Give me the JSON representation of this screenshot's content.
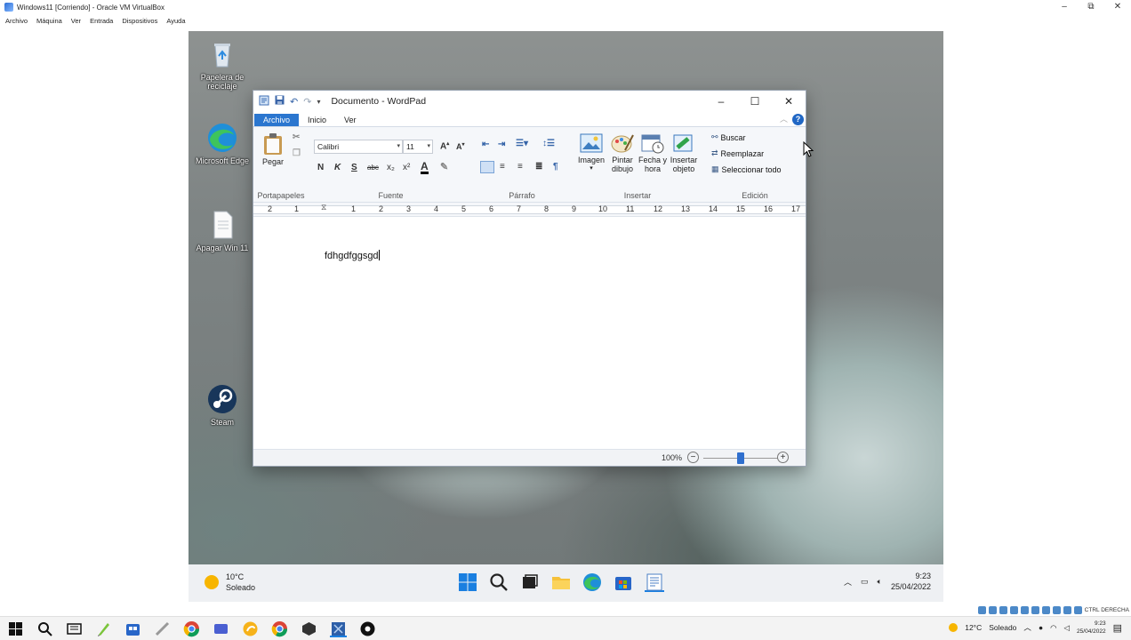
{
  "host": {
    "title": "Windows11 [Corriendo] - Oracle VM VirtualBox",
    "controls": [
      "–",
      "⧉",
      "✕"
    ],
    "menu": [
      "Archivo",
      "Máquina",
      "Ver",
      "Entrada",
      "Dispositivos",
      "Ayuda"
    ],
    "status_text": "CTRL DERECHA",
    "tray": {
      "temp": "12°C",
      "weather": "Soleado",
      "time": "9:23",
      "date": "25/04/2022"
    }
  },
  "desktop": {
    "icons": [
      {
        "label": "Papelera de reciclaje",
        "icon": "recycle-bin-icon"
      },
      {
        "label": "Microsoft Edge",
        "icon": "edge-icon"
      },
      {
        "label": "Apagar Win 11",
        "icon": "text-file-icon"
      },
      {
        "label": "Steam",
        "icon": "steam-icon"
      }
    ]
  },
  "wordpad": {
    "title": "Documento - WordPad",
    "tabs": {
      "file": "Archivo",
      "home": "Inicio",
      "view": "Ver"
    },
    "help": "?",
    "clipboard": {
      "paste": "Pegar",
      "label": "Portapapeles"
    },
    "font": {
      "family": "Calibri",
      "size": "11",
      "label": "Fuente",
      "bold": "N",
      "italic": "K",
      "underline": "S",
      "strike": "abc",
      "sub": "x₂",
      "sup": "x²",
      "color_a": "A"
    },
    "paragraph": {
      "label": "Párrafo"
    },
    "insert": {
      "label": "Insertar",
      "image": "Imagen",
      "paint": "Pintar dibujo",
      "datetime": "Fecha y hora",
      "object": "Insertar objeto"
    },
    "edit": {
      "label": "Edición",
      "find": "Buscar",
      "replace": "Reemplazar",
      "select_all": "Seleccionar todo"
    },
    "ruler": [
      "2",
      "1",
      "1",
      "2",
      "3",
      "4",
      "5",
      "6",
      "7",
      "8",
      "9",
      "10",
      "11",
      "12",
      "13",
      "14",
      "15",
      "16",
      "17"
    ],
    "document_text": "fdhgdfggsgd",
    "zoom": "100%",
    "zoom_level": 0.5
  },
  "guest_taskbar": {
    "weather_temp": "10°C",
    "weather_desc": "Soleado",
    "time": "9:23",
    "date": "25/04/2022"
  }
}
